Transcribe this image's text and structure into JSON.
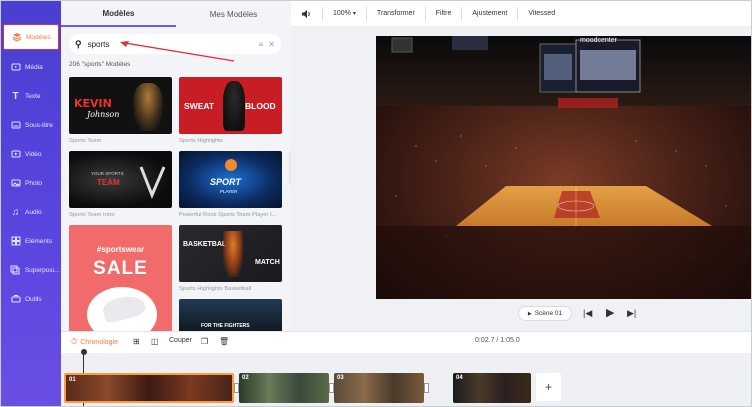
{
  "nav": {
    "items": [
      {
        "label": "Modèles",
        "icon": "layers-icon",
        "active": true
      },
      {
        "label": "Média",
        "icon": "media-icon"
      },
      {
        "label": "Texte",
        "icon": "text-icon"
      },
      {
        "label": "Sous-titre",
        "icon": "subtitle-icon"
      },
      {
        "label": "Vidéo",
        "icon": "video-icon"
      },
      {
        "label": "Photo",
        "icon": "photo-icon"
      },
      {
        "label": "Audio",
        "icon": "audio-icon"
      },
      {
        "label": "Eléments",
        "icon": "elements-icon"
      },
      {
        "label": "Superposi...",
        "icon": "overlay-icon"
      },
      {
        "label": "Outils",
        "icon": "tools-icon"
      }
    ]
  },
  "panel": {
    "tabs": [
      "Modèles",
      "Mes Modèles"
    ],
    "search_value": "sports",
    "result_count": "206 \"sports\" Modèles",
    "templates": [
      {
        "label": "Sports Team",
        "text1": "KEVIN",
        "text2": "Johnson"
      },
      {
        "label": "Sports Highlights",
        "text1": "SWEAT",
        "text2": "BLOOD"
      },
      {
        "label": "Sports Team Intro",
        "text1": "YOUR SPORTS",
        "text2": "TEAM"
      },
      {
        "label": "Powerful Rock Sports Team Player I...",
        "text1": "SPORT",
        "text2": "PLAYER"
      },
      {
        "label": "",
        "text1": "#sportswear",
        "text2": "SALE"
      },
      {
        "label": "Sports Highlights Basketball",
        "text1": "BASKETBALL",
        "text2": "MATCH"
      },
      {
        "label": "",
        "text1": "FOR THE FIGHTERS",
        "text2": ""
      }
    ]
  },
  "toolbar": {
    "zoom": "100%",
    "transform": "Transformer",
    "filter": "Filtre",
    "adjust": "Ajustement",
    "speed": "Vitessed"
  },
  "preview": {
    "arena_sign": "moodcenter",
    "scene_label": "Scène 01"
  },
  "timeline": {
    "label": "Chronologie",
    "cut_label": "Couper",
    "time": "0:02.7 / 1:05.0",
    "clips": [
      "01",
      "02",
      "03",
      "04"
    ]
  },
  "colors": {
    "nav_bg": "#5244d8",
    "accent": "#ff7a3d",
    "active_border": "#e0303a",
    "tab_underline": "#6d58e8"
  }
}
